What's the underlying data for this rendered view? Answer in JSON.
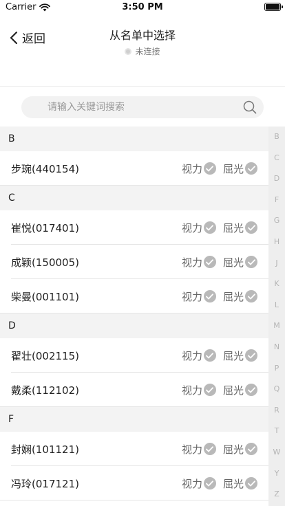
{
  "status_bar": {
    "carrier": "Carrier",
    "time": "3:50 PM"
  },
  "nav": {
    "back_label": "返回",
    "title": "从名单中选择",
    "subtitle": "未连接"
  },
  "search": {
    "placeholder": "请输入关键词搜索",
    "value": ""
  },
  "tag_labels": {
    "vision": "视力",
    "refraction": "屈光"
  },
  "sections": [
    {
      "letter": "B",
      "items": [
        "步琬(440154)"
      ]
    },
    {
      "letter": "C",
      "items": [
        "崔悦(017401)",
        "成颖(150005)",
        "柴曼(001101)"
      ]
    },
    {
      "letter": "D",
      "items": [
        "翟壮(002115)",
        "戴柔(112102)"
      ]
    },
    {
      "letter": "F",
      "items": [
        "封娴(101121)",
        "冯玲(017121)"
      ]
    }
  ],
  "index_letters": [
    "B",
    "C",
    "D",
    "F",
    "G",
    "H",
    "J",
    "K",
    "L",
    "M",
    "N",
    "P",
    "Q",
    "R",
    "T",
    "W",
    "Y",
    "Z"
  ],
  "colors": {
    "check_bg": "#b9b9b9",
    "section_bg": "#f3f3f3",
    "index_bg": "#eeeeee"
  }
}
